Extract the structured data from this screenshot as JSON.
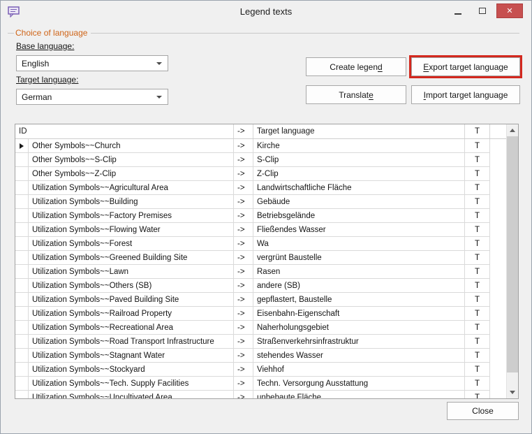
{
  "window": {
    "title": "Legend texts"
  },
  "icons": {
    "dialog_icon": "speech-bubble",
    "minimize": "minimize-bar",
    "maximize": "maximize-box",
    "close_glyph": "✕",
    "combo_arrow": "chevron-down",
    "current_row_indicator": "triangle-right",
    "scroll_up": "triangle-up",
    "scroll_down": "triangle-down"
  },
  "colors": {
    "group_title": "#cf6417",
    "export_highlight_border": "#d3281e",
    "titlebar_close_button": "#c75050"
  },
  "group": {
    "title": "Choice of language"
  },
  "form": {
    "base_language": {
      "label": "Base language:",
      "value": "English"
    },
    "target_language": {
      "label": "Target language:",
      "value": "German"
    }
  },
  "buttons": {
    "create_legend": "Create legen&d",
    "export_target_language": "&Export target language",
    "translate": "Translat&e",
    "import_target_language": "&Import target language",
    "close": "Close"
  },
  "table": {
    "headers": {
      "id": "ID",
      "arrow": "->",
      "target_language": "Target language",
      "t": "T"
    },
    "rows": [
      {
        "id": "Other Symbols~~Church",
        "arrow": "->",
        "target": "Kirche",
        "t": "T",
        "current": true
      },
      {
        "id": "Other Symbols~~S-Clip",
        "arrow": "->",
        "target": "S-Clip",
        "t": "T"
      },
      {
        "id": "Other Symbols~~Z-Clip",
        "arrow": "->",
        "target": "Z-Clip",
        "t": "T"
      },
      {
        "id": "Utilization Symbols~~Agricultural Area",
        "arrow": "->",
        "target": "Landwirtschaftliche Fläche",
        "t": "T"
      },
      {
        "id": "Utilization Symbols~~Building",
        "arrow": "->",
        "target": "Gebäude",
        "t": "T"
      },
      {
        "id": "Utilization Symbols~~Factory Premises",
        "arrow": "->",
        "target": "Betriebsgelände",
        "t": "T"
      },
      {
        "id": "Utilization Symbols~~Flowing Water",
        "arrow": "->",
        "target": "Fließendes Wasser",
        "t": "T"
      },
      {
        "id": "Utilization Symbols~~Forest",
        "arrow": "->",
        "target": "Wa",
        "t": "T"
      },
      {
        "id": "Utilization Symbols~~Greened Building Site",
        "arrow": "->",
        "target": "vergrünt Baustelle",
        "t": "T"
      },
      {
        "id": "Utilization Symbols~~Lawn",
        "arrow": "->",
        "target": "Rasen",
        "t": "T"
      },
      {
        "id": "Utilization Symbols~~Others (SB)",
        "arrow": "->",
        "target": "andere (SB)",
        "t": "T"
      },
      {
        "id": "Utilization Symbols~~Paved Building Site",
        "arrow": "->",
        "target": "gepflastert, Baustelle",
        "t": "T"
      },
      {
        "id": "Utilization Symbols~~Railroad Property",
        "arrow": "->",
        "target": "Eisenbahn-Eigenschaft",
        "t": "T"
      },
      {
        "id": "Utilization Symbols~~Recreational Area",
        "arrow": "->",
        "target": "Naherholungsgebiet",
        "t": "T"
      },
      {
        "id": "Utilization Symbols~~Road Transport Infrastructure",
        "arrow": "->",
        "target": "Straßenverkehrsinfrastruktur",
        "t": "T"
      },
      {
        "id": "Utilization Symbols~~Stagnant Water",
        "arrow": "->",
        "target": "stehendes Wasser",
        "t": "T"
      },
      {
        "id": "Utilization Symbols~~Stockyard",
        "arrow": "->",
        "target": "Viehhof",
        "t": "T"
      },
      {
        "id": "Utilization Symbols~~Tech. Supply Facilities",
        "arrow": "->",
        "target": "Techn. Versorgung Ausstattung",
        "t": "T"
      },
      {
        "id": "Utilization Symbols~~Uncultivated Area",
        "arrow": "->",
        "target": "unbebaute Fläche",
        "t": "T"
      }
    ]
  }
}
